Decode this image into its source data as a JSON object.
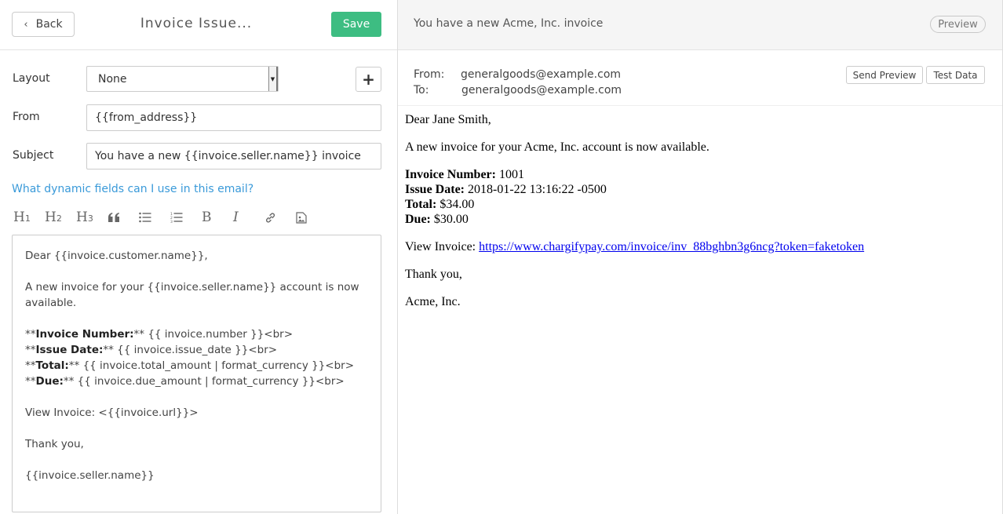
{
  "editor": {
    "back_label": "Back",
    "title": "Invoice Issue...",
    "save_label": "Save",
    "layout_label": "Layout",
    "layout_value": "None",
    "from_label": "From",
    "from_value": "{{from_address}}",
    "subject_label": "Subject",
    "subject_value": "You have a new {{invoice.seller.name}} invoice",
    "help_link": "What dynamic fields can I use in this email?",
    "toolbar": {
      "h1": "H",
      "h1_sub": "1",
      "h2": "H",
      "h2_sub": "2",
      "h3": "H",
      "h3_sub": "3",
      "bold": "B",
      "italic": "I"
    },
    "body": {
      "greeting": "Dear {{invoice.customer.name}},",
      "intro": "A new invoice for your {{invoice.seller.name}} account is now available.",
      "lines": [
        {
          "prefix": "**",
          "label": "Invoice Number:",
          "rest": "** {{ invoice.number }}<br>"
        },
        {
          "prefix": "**",
          "label": "Issue Date:",
          "rest": "** {{ invoice.issue_date }}<br>"
        },
        {
          "prefix": "**",
          "label": "Total:",
          "rest": "** {{ invoice.total_amount | format_currency }}<br>"
        },
        {
          "prefix": "**",
          "label": "Due:",
          "rest": "** {{ invoice.due_amount | format_currency }}<br>"
        }
      ],
      "view": "View Invoice: <{{invoice.url}}>",
      "thanks": "Thank you,",
      "signature": "{{invoice.seller.name}}"
    }
  },
  "preview": {
    "subject": "You have a new Acme, Inc. invoice",
    "badge": "Preview",
    "from_label": "From:",
    "from_value": "generalgoods@example.com",
    "to_label": "To:",
    "to_value": "generalgoods@example.com",
    "send_preview_label": "Send Preview",
    "test_data_label": "Test Data",
    "body": {
      "greeting": "Dear Jane Smith,",
      "intro": "A new invoice for your Acme, Inc. account is now available.",
      "details": [
        {
          "label": "Invoice Number:",
          "value": "1001"
        },
        {
          "label": "Issue Date:",
          "value": "2018-01-22 13:16:22 -0500"
        },
        {
          "label": "Total:",
          "value": "$34.00"
        },
        {
          "label": "Due:",
          "value": "$30.00"
        }
      ],
      "view_prefix": "View Invoice:",
      "view_url": "https://www.chargifypay.com/invoice/inv_88bghbn3g6ncg?token=faketoken",
      "thanks": "Thank you,",
      "signature": "Acme, Inc."
    }
  },
  "colors": {
    "save": "#3dbd82",
    "link": "#3a9ad9",
    "preview_link": "#0000ee"
  }
}
